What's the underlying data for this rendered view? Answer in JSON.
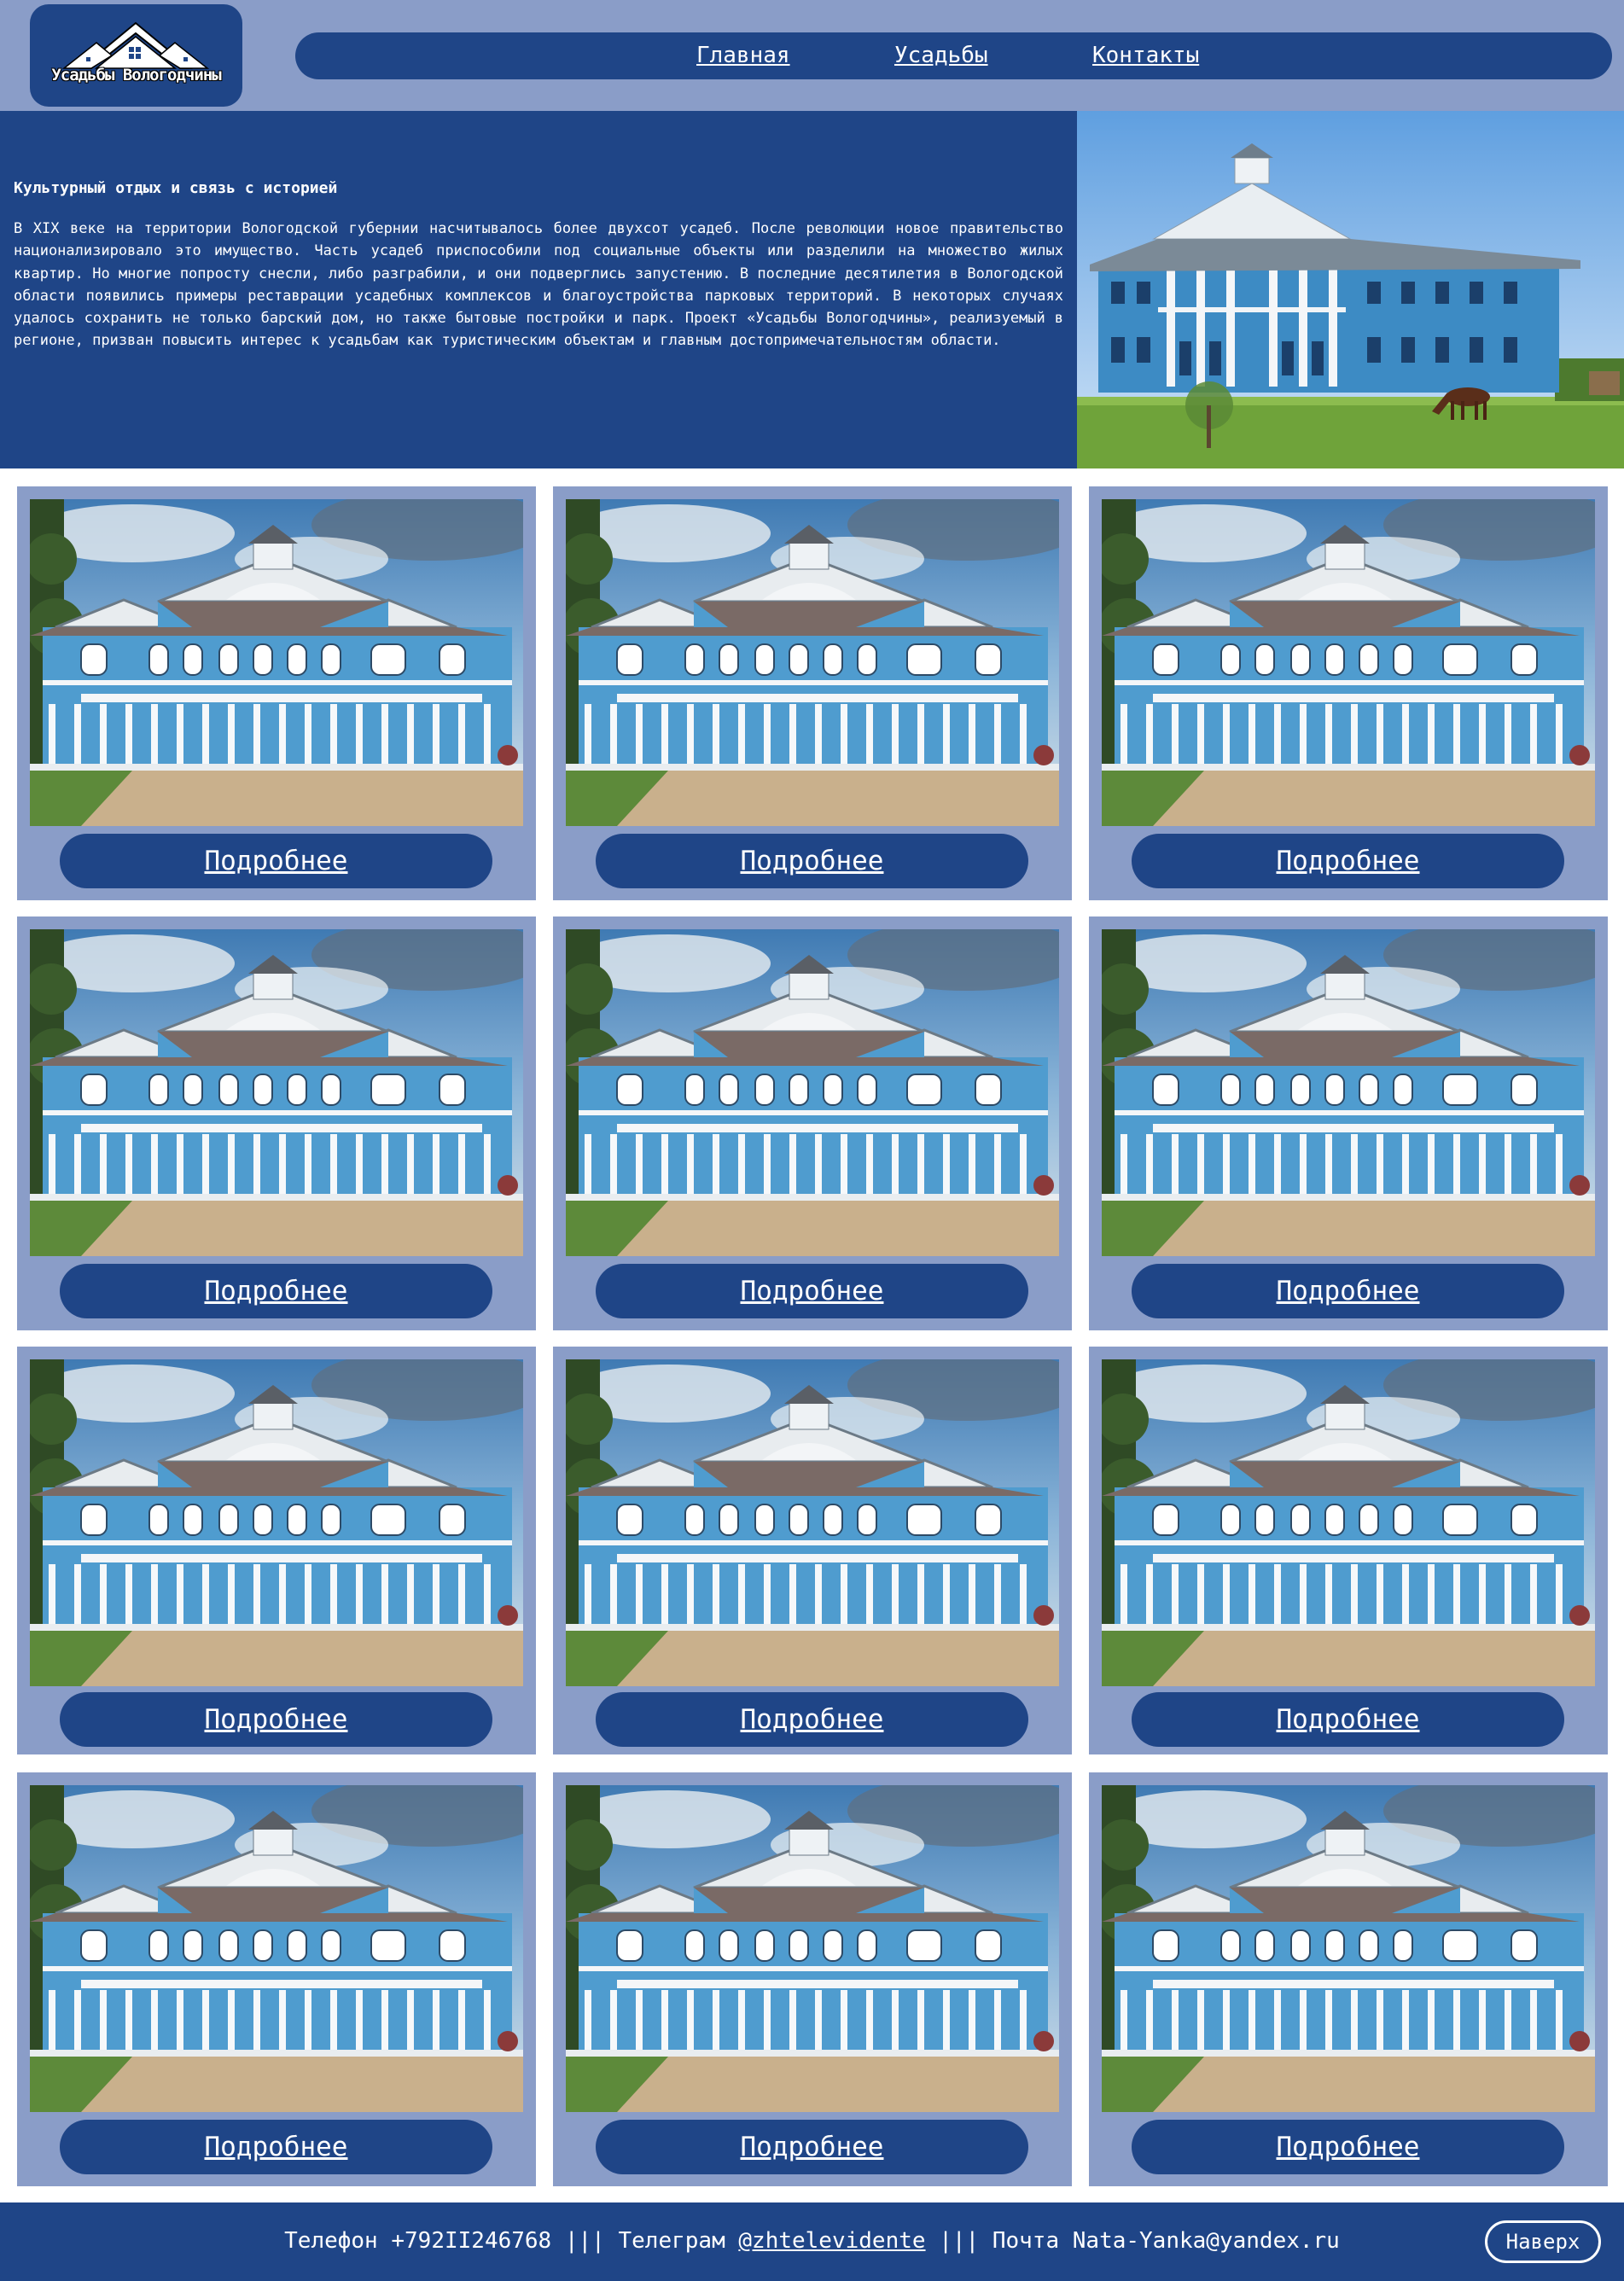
{
  "header": {
    "logo_text": "Усадьбы Вологодчины",
    "nav": [
      {
        "label": "Главная"
      },
      {
        "label": "Усадьбы"
      },
      {
        "label": "Контакты"
      }
    ]
  },
  "hero": {
    "title": "Культурный отдых и связь с историей",
    "body": "В XIX веке на территории Вологодской губернии насчитывалось более двухсот усадеб. После революции новое правительство национализировало это имущество. Часть усадеб приспособили под социальные объекты или разделили на множество жилых квартир. Но многие попросту снесли, либо разграбили, и они подверглись запустению. В последние десятилетия в Вологодской области появились примеры реставрации усадебных комплексов и благоустройства парковых территорий. В некоторых случаях удалось сохранить не только барский дом, но также бытовые постройки и парк. Проект «Усадьбы Вологодчины», реализуемый в регионе, призван повысить интерес к усадьбам как туристическим объектам и главным достопримечательностям области."
  },
  "cards": {
    "button_label": "Подробнее",
    "count": 12
  },
  "footer": {
    "phone_label": "Телефон",
    "phone": "+792II246768",
    "separator": "|||",
    "telegram_label": "Телеграм",
    "telegram": "@zhtelevidente",
    "mail_label": "Почта",
    "mail": "Nata-Yanka@yandex.ru",
    "top_button": "Наверх"
  },
  "colors": {
    "primary": "#1f4587",
    "secondary": "#8a9dc8",
    "background": "#ffffff"
  }
}
